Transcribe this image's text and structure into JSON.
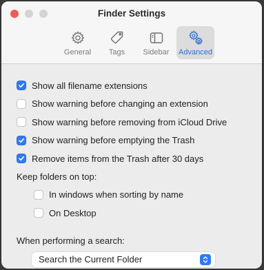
{
  "window": {
    "title": "Finder Settings",
    "traffic_colors": [
      "#ec5f56",
      "#d4d4d4",
      "#d4d4d4"
    ]
  },
  "tabs": [
    {
      "label": "General",
      "icon": "gear-icon",
      "active": false
    },
    {
      "label": "Tags",
      "icon": "tag-icon",
      "active": false
    },
    {
      "label": "Sidebar",
      "icon": "sidebar-icon",
      "active": false
    },
    {
      "label": "Advanced",
      "icon": "gears-icon",
      "active": true
    }
  ],
  "options": [
    {
      "label": "Show all filename extensions",
      "checked": true
    },
    {
      "label": "Show warning before changing an extension",
      "checked": false
    },
    {
      "label": "Show warning before removing from iCloud Drive",
      "checked": false
    },
    {
      "label": "Show warning before emptying the Trash",
      "checked": true
    },
    {
      "label": "Remove items from the Trash after 30 days",
      "checked": true
    }
  ],
  "folders_on_top": {
    "heading": "Keep folders on top:",
    "options": [
      {
        "label": "In windows when sorting by name",
        "checked": false
      },
      {
        "label": "On Desktop",
        "checked": false
      }
    ]
  },
  "search": {
    "heading": "When performing a search:",
    "selected": "Search the Current Folder"
  },
  "colors": {
    "accent": "#2f7bf5",
    "active_tab_label": "#2f6fd6"
  }
}
